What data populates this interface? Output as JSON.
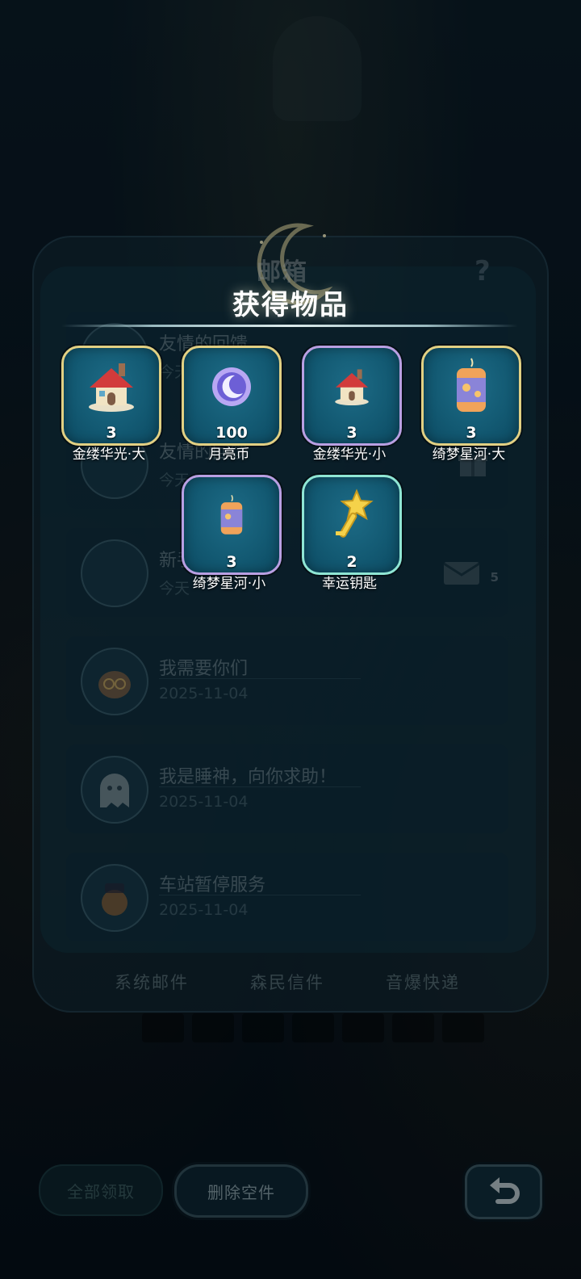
{
  "mailbox": {
    "title": "邮箱",
    "help": "?",
    "mails": [
      {
        "title": "友情的回馈",
        "date": "今天"
      },
      {
        "title": "友情的回馈",
        "date": "今天"
      },
      {
        "title": "新手",
        "date": "今天",
        "count": "5"
      },
      {
        "title": "我需要你们",
        "date": "2025-11-04"
      },
      {
        "title": "我是睡神，向你求助！",
        "date": "2025-11-04"
      },
      {
        "title": "车站暂停服务",
        "date": "2025-11-04"
      }
    ],
    "tabs": [
      "系统邮件",
      "森民信件",
      "音爆快递"
    ]
  },
  "footer": {
    "claim_all": "全部领取",
    "delete_empty": "删除空件"
  },
  "reward": {
    "header": "获得物品",
    "items": [
      {
        "name": "金缕华光·大",
        "count": "3",
        "icon": "house-icon"
      },
      {
        "name": "月亮币",
        "count": "100",
        "icon": "moon-coin-icon"
      },
      {
        "name": "金缕华光·小",
        "count": "3",
        "icon": "house-icon"
      },
      {
        "name": "绮梦星河·大",
        "count": "3",
        "icon": "lantern-icon"
      },
      {
        "name": "绮梦星河·小",
        "count": "3",
        "icon": "lantern-icon"
      },
      {
        "name": "幸运钥匙",
        "count": "2",
        "icon": "star-key-icon"
      }
    ]
  }
}
